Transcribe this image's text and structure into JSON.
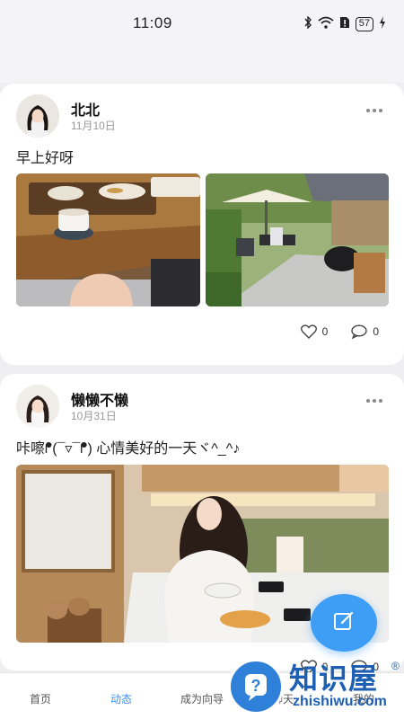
{
  "status": {
    "time": "11:09",
    "battery": "57"
  },
  "posts": [
    {
      "username": "北北",
      "date": "11月10日",
      "text": "早上好呀",
      "likes": "0",
      "comments": "0"
    },
    {
      "username": "懒懒不懒",
      "date": "10月31日",
      "text": "咔嚓ᖰ(¯▿¯ᖰ) 心情美好的一天ヾ^_^♪",
      "likes": "0",
      "comments": "0"
    }
  ],
  "tabs": [
    "首页",
    "动态",
    "成为向导",
    "聊天",
    "我的"
  ],
  "active_tab": "动态",
  "icons": {
    "more": "more-icon",
    "like": "heart-icon",
    "comment": "comment-icon",
    "compose": "edit-icon"
  },
  "watermark": {
    "cn": "知识屋",
    "en": "zhishiwu.com",
    "reg": "®"
  },
  "colors": {
    "accent": "#3e9ef5",
    "active_tab": "#3a8ff0"
  }
}
